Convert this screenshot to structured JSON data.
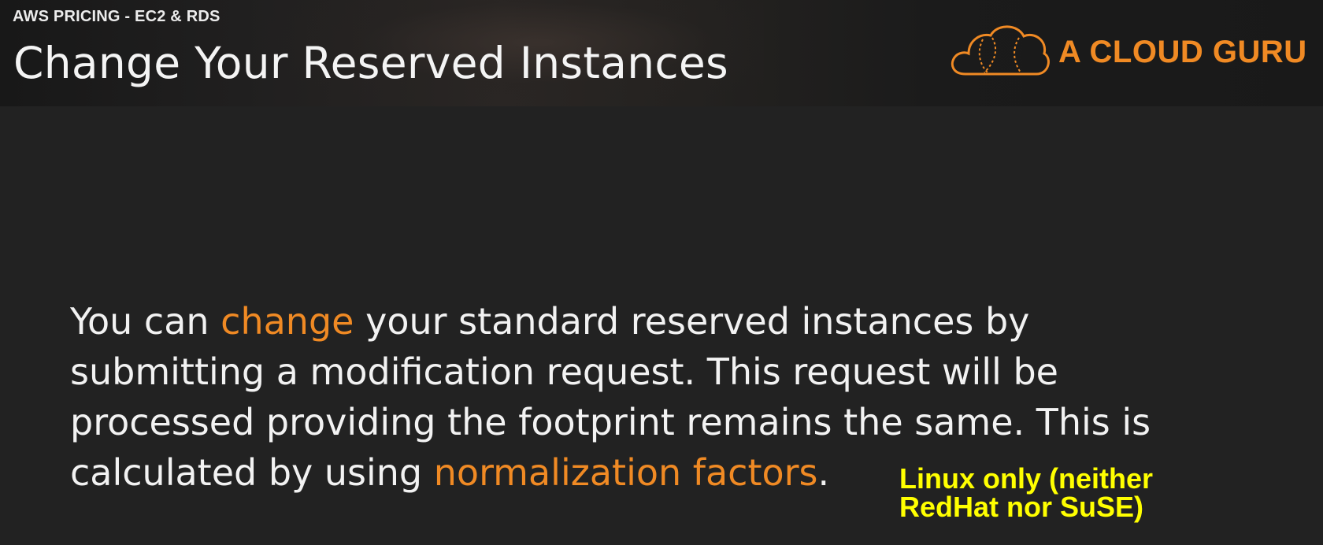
{
  "header": {
    "course_label": "AWS PRICING - EC2 & RDS",
    "title": "Change Your Reserved Instances",
    "logo": {
      "icon": "cloud-icon",
      "text": "A CLOUD GURU",
      "color": "#f08a24"
    }
  },
  "body": {
    "lines": [
      [
        {
          "text": "You can ",
          "highlight": false
        },
        {
          "text": "change",
          "highlight": true
        },
        {
          "text": " your standard reserved instances by",
          "highlight": false
        }
      ],
      [
        {
          "text": "submitting a modification request. This request will be",
          "highlight": false
        }
      ],
      [
        {
          "text": "processed providing the footprint remains the same. This is",
          "highlight": false
        }
      ],
      [
        {
          "text": "calculated by using ",
          "highlight": false
        },
        {
          "text": "normalization factors",
          "highlight": true
        },
        {
          "text": ".",
          "highlight": false
        }
      ]
    ],
    "highlight_color": "#f08a24"
  },
  "caption": {
    "line1": "Linux only (neither",
    "line2": "RedHat nor SuSE)",
    "color": "#ffff00"
  }
}
